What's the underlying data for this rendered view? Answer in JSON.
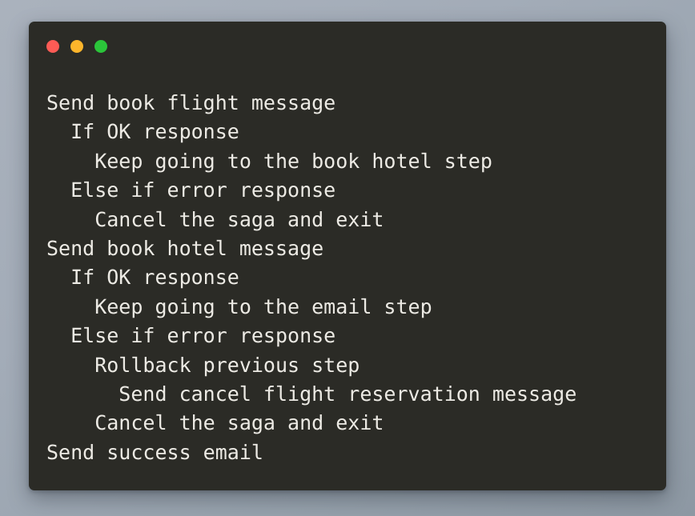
{
  "window": {
    "kind": "terminal-window",
    "background_color": "#2b2b26",
    "text_color": "#eceae4",
    "page_background_color": "#a3acb8",
    "titlebar": {
      "buttons": [
        {
          "name": "close-button",
          "label": "Close",
          "color": "#fc5b55"
        },
        {
          "name": "minimize-button",
          "label": "Minimize",
          "color": "#fcb52b"
        },
        {
          "name": "maximize-button",
          "label": "Maximize",
          "color": "#2bc53a"
        }
      ]
    }
  },
  "content": {
    "lines": [
      {
        "indent": 0,
        "text": "Send book flight message"
      },
      {
        "indent": 1,
        "text": "If OK response"
      },
      {
        "indent": 2,
        "text": "Keep going to the book hotel step"
      },
      {
        "indent": 1,
        "text": "Else if error response"
      },
      {
        "indent": 2,
        "text": "Cancel the saga and exit"
      },
      {
        "indent": 0,
        "text": "Send book hotel message"
      },
      {
        "indent": 1,
        "text": "If OK response"
      },
      {
        "indent": 2,
        "text": "Keep going to the email step"
      },
      {
        "indent": 1,
        "text": "Else if error response"
      },
      {
        "indent": 2,
        "text": "Rollback previous step"
      },
      {
        "indent": 3,
        "text": "Send cancel flight reservation message"
      },
      {
        "indent": 2,
        "text": "Cancel the saga and exit"
      },
      {
        "indent": 0,
        "text": "Send success email"
      }
    ],
    "indent_unit_spaces": 2
  }
}
